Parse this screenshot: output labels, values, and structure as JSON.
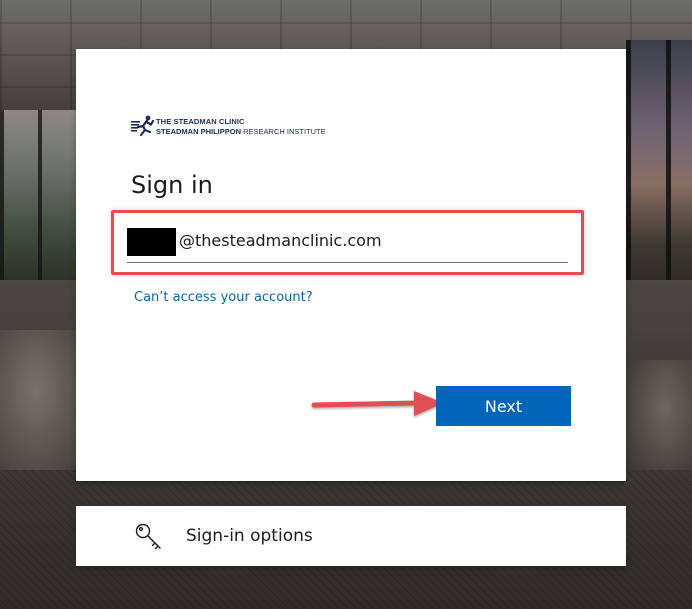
{
  "organization": {
    "logo_line1": "THE STEADMAN CLINIC",
    "logo_line2_bold": "STEADMAN PHILIPPON",
    "logo_line2_rest": "RESEARCH INSTITUTE",
    "logo_icon": "running-figure-icon"
  },
  "signin": {
    "title": "Sign in",
    "email_domain": "@thesteadmanclinic.com",
    "email_user_redacted": true,
    "forgot_link": "Can’t access your account?",
    "next_label": "Next"
  },
  "options": {
    "label": "Sign-in options",
    "icon": "key-icon"
  },
  "annotations": {
    "highlight_color": "#e05052",
    "arrow_color": "#e05052"
  },
  "colors": {
    "accent": "#0067b8",
    "card_bg": "#ffffff"
  }
}
